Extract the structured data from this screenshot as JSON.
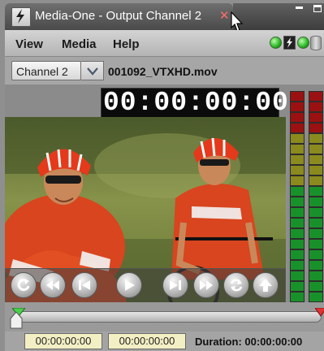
{
  "window": {
    "title": "Media-One - Output Channel 2",
    "close_glyph": "✕"
  },
  "menu": {
    "items": [
      "View",
      "Media",
      "Help"
    ]
  },
  "status_icons": [
    "green-led-icon",
    "lightning-icon",
    "green-led-icon",
    "database-icon"
  ],
  "channel": {
    "selected": "Channel 2",
    "filename": "001092_VTXHD.mov"
  },
  "timecode": "00:00:00:00",
  "transport": {
    "buttons": [
      "loop",
      "rewind",
      "step-back",
      "play",
      "step-forward",
      "fast-forward",
      "sync",
      "eject"
    ]
  },
  "meters": {
    "segments_per_channel": 20,
    "colors": {
      "red": "#9b1111",
      "yellow": "#8b8a1e",
      "green": "#19912a"
    }
  },
  "bottom": {
    "in_point": "00:00:00:00",
    "out_point": "00:00:00:00",
    "duration_label": "Duration:",
    "duration_value": "00:00:00:00"
  },
  "colors": {
    "accent": "#27b321",
    "tc_field_bg": "#f3efc4"
  }
}
